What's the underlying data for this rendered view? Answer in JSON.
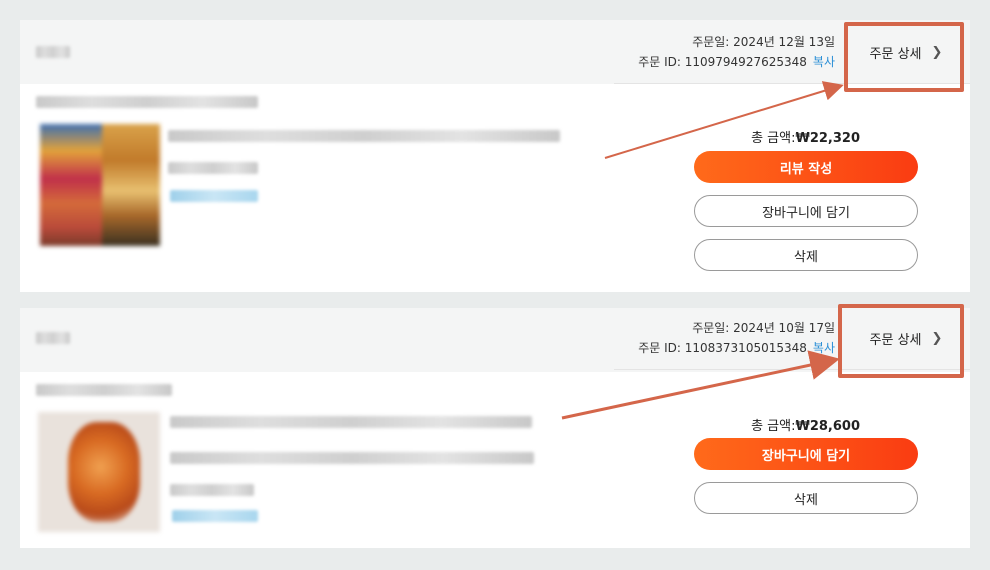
{
  "orders": [
    {
      "order_date": "주문일: 2024년 12월 13일",
      "order_id": "주문 ID: 1109794927625348",
      "copy_label": "복사",
      "detail_label": "주문 상세",
      "detail_icon": "chevron-right-icon",
      "total_label": "총 금액:",
      "total_value": "₩22,320",
      "buttons": [
        "리뷰 작성",
        "장바구니에 담기",
        "삭제"
      ]
    },
    {
      "order_date": "주문일: 2024년 10월 17일",
      "order_id": "주문 ID: 1108373105015348",
      "copy_label": "복사",
      "detail_label": "주문 상세",
      "detail_icon": "chevron-right-icon",
      "total_label": "총 금액:",
      "total_value": "₩28,600",
      "buttons": [
        "장바구니에 담기",
        "삭제"
      ]
    }
  ],
  "colors": {
    "accent": "#fa4c14",
    "link": "#2a8fd6",
    "annotation": "#d4664a"
  }
}
